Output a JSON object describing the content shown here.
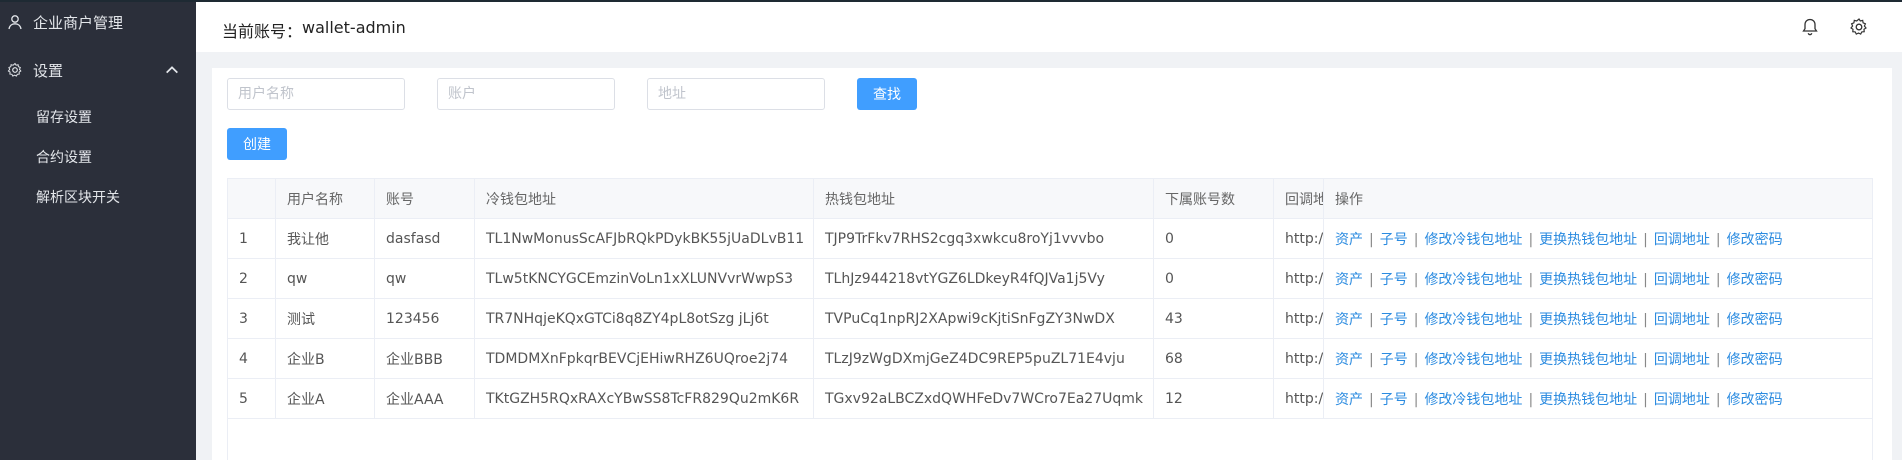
{
  "sidebar": {
    "merchant_label": "企业商户管理",
    "settings_label": "设置",
    "sub_items": [
      "留存设置",
      "合约设置",
      "解析区块开关"
    ]
  },
  "header": {
    "account_prefix": "当前账号：",
    "account_name": "wallet-admin"
  },
  "filters": {
    "username_placeholder": "用户名称",
    "account_placeholder": "账户",
    "address_placeholder": "地址",
    "search_label": "查找",
    "create_label": "创建"
  },
  "table": {
    "headers": [
      "",
      "用户名称",
      "账号",
      "冷钱包地址",
      "热钱包地址",
      "下属账号数",
      "回调地",
      "操作"
    ],
    "rows": [
      {
        "idx": "1",
        "name": "我让他",
        "account": "dasfasd",
        "cold": "TL1NwMonusScAFJbRQkPDykBK55jUaDLvB11",
        "hot": "TJP9TrFkv7RHS2cgq3xwkcu8roYj1vvvbo",
        "subs": "0",
        "callback": "http://"
      },
      {
        "idx": "2",
        "name": "qw",
        "account": "qw",
        "cold": "TLw5tKNCYGCEmzinVoLn1xXLUNVvrWwpS3",
        "hot": "TLhJz944218vtYGZ6LDkeyR4fQJVa1j5Vy",
        "subs": "0",
        "callback": "http://"
      },
      {
        "idx": "3",
        "name": "测试",
        "account": "123456",
        "cold": "TR7NHqjeKQxGTCi8q8ZY4pL8otSzg jLj6t",
        "hot": "TVPuCq1npRJ2XApwi9cKjtiSnFgZY3NwDX",
        "subs": "43",
        "callback": "http://"
      },
      {
        "idx": "4",
        "name": "企业B",
        "account": "企业BBB",
        "cold": "TDMDMXnFpkqrBEVCjEHiwRHZ6UQroe2j74",
        "hot": "TLzJ9zWgDXmjGeZ4DC9REP5puZL71E4vju",
        "subs": "68",
        "callback": "http://"
      },
      {
        "idx": "5",
        "name": "企业A",
        "account": "企业AAA",
        "cold": "TKtGZH5RQxRAXcYBwSS8TcFR829Qu2mK6R",
        "hot": "TGxv92aLBCZxdQWHFeDv7WCro7Ea27Uqmk",
        "subs": "12",
        "callback": "http://"
      }
    ],
    "actions": [
      "资产",
      "子号",
      "修改冷钱包地址",
      "更换热钱包地址",
      "回调地址",
      "修改密码"
    ],
    "action_separator": "|"
  },
  "icons": [
    "user-icon",
    "gear-icon",
    "chevron-up-icon",
    "bell-icon",
    "settings-gear-icon"
  ],
  "colors": {
    "sidebar_bg": "#2b2f3a",
    "primary": "#409eff",
    "link": "#2b8be0"
  }
}
